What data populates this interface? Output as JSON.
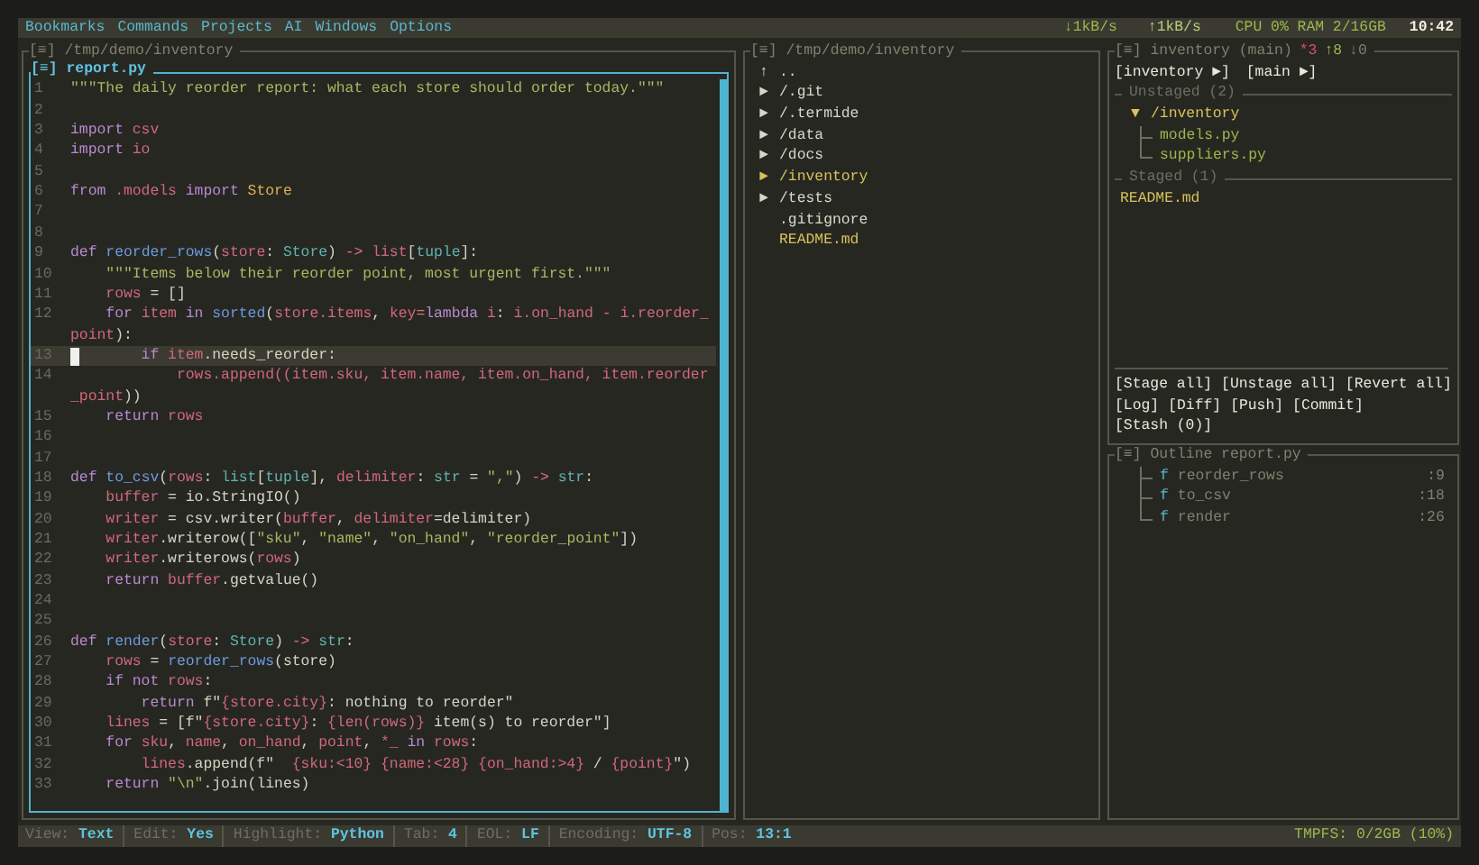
{
  "menu_bar": {
    "items": [
      "Bookmarks",
      "Commands",
      "Projects",
      "AI",
      "Windows",
      "Options"
    ],
    "net_down": "↓1kB/s",
    "net_up": "↑1kB/s",
    "system": "CPU 0% RAM 2/16GB",
    "clock": "10:42"
  },
  "project_panel": {
    "glyph": "[≡]",
    "title": "/tmp/demo/inventory"
  },
  "editor": {
    "glyph": "[≡]",
    "title": "report.py",
    "rows": [
      {
        "number": "1",
        "current": false,
        "tokens": [
          {
            "text": "\"\"\"The daily reorder report: what each store should order today.\"\"\"",
            "kind": "s"
          }
        ]
      },
      {
        "number": "2",
        "current": false,
        "tokens": []
      },
      {
        "number": "3",
        "current": false,
        "tokens": [
          {
            "text": "import",
            "kind": "k"
          },
          {
            "text": " csv",
            "kind": "v"
          }
        ]
      },
      {
        "number": "4",
        "current": false,
        "tokens": [
          {
            "text": "import",
            "kind": "k"
          },
          {
            "text": " io",
            "kind": "v"
          }
        ]
      },
      {
        "number": "5",
        "current": false,
        "tokens": []
      },
      {
        "number": "6",
        "current": false,
        "tokens": [
          {
            "text": "from",
            "kind": "k"
          },
          {
            "text": " .models",
            "kind": "v"
          },
          {
            "text": " import",
            "kind": "k"
          },
          {
            "text": " Store",
            "kind": "c"
          }
        ]
      },
      {
        "number": "7",
        "current": false,
        "tokens": []
      },
      {
        "number": "8",
        "current": false,
        "tokens": []
      },
      {
        "number": "9",
        "current": false,
        "tokens": [
          {
            "text": "def",
            "kind": "k"
          },
          {
            "text": " reorder_rows",
            "kind": "f"
          },
          {
            "text": "(",
            "kind": "p"
          },
          {
            "text": "store",
            "kind": "v"
          },
          {
            "text": ": ",
            "kind": "p"
          },
          {
            "text": "Store",
            "kind": "t"
          },
          {
            "text": ") ",
            "kind": "p"
          },
          {
            "text": "->",
            "kind": "o"
          },
          {
            "text": " list",
            "kind": "v"
          },
          {
            "text": "[",
            "kind": "p"
          },
          {
            "text": "tuple",
            "kind": "t"
          },
          {
            "text": "]:",
            "kind": "p"
          }
        ]
      },
      {
        "number": "10",
        "current": false,
        "tokens": [
          {
            "text": "    \"\"\"Items below their reorder point, most urgent first.\"\"\"",
            "kind": "s"
          }
        ]
      },
      {
        "number": "11",
        "current": false,
        "tokens": [
          {
            "text": "    rows",
            "kind": "v"
          },
          {
            "text": " = []",
            "kind": "p"
          }
        ]
      },
      {
        "number": "12",
        "current": false,
        "tokens": [
          {
            "text": "    for",
            "kind": "k"
          },
          {
            "text": " item",
            "kind": "v"
          },
          {
            "text": " in",
            "kind": "k"
          },
          {
            "text": " sorted",
            "kind": "f"
          },
          {
            "text": "(",
            "kind": "p"
          },
          {
            "text": "store.items",
            "kind": "v"
          },
          {
            "text": ", ",
            "kind": "p"
          },
          {
            "text": "key",
            "kind": "v"
          },
          {
            "text": "=",
            "kind": "o"
          },
          {
            "text": "lambda",
            "kind": "k"
          },
          {
            "text": " i",
            "kind": "v"
          },
          {
            "text": ": ",
            "kind": "p"
          },
          {
            "text": "i.on_hand",
            "kind": "v"
          },
          {
            "text": " - ",
            "kind": "o"
          },
          {
            "text": "i.reorder_",
            "kind": "v"
          }
        ]
      },
      {
        "current": false,
        "tokens": [
          {
            "text": "point",
            "kind": "v"
          },
          {
            "text": "):",
            "kind": "p"
          }
        ]
      },
      {
        "number": "13",
        "current": true,
        "tokens": [
          {
            "text": "        if",
            "kind": "k"
          },
          {
            "text": " item",
            "kind": "v"
          },
          {
            "text": ".needs_reorder:",
            "kind": "p"
          }
        ]
      },
      {
        "number": "14",
        "current": false,
        "tokens": [
          {
            "text": "            rows.append((item.sku, item.name, item.on_hand, item.reorder",
            "kind": "v"
          }
        ]
      },
      {
        "current": false,
        "tokens": [
          {
            "text": "_point",
            "kind": "v"
          },
          {
            "text": "))",
            "kind": "p"
          }
        ]
      },
      {
        "number": "15",
        "current": false,
        "tokens": [
          {
            "text": "    return",
            "kind": "k"
          },
          {
            "text": " rows",
            "kind": "v"
          }
        ]
      },
      {
        "number": "16",
        "current": false,
        "tokens": []
      },
      {
        "number": "17",
        "current": false,
        "tokens": []
      },
      {
        "number": "18",
        "current": false,
        "tokens": [
          {
            "text": "def",
            "kind": "k"
          },
          {
            "text": " to_csv",
            "kind": "f"
          },
          {
            "text": "(",
            "kind": "p"
          },
          {
            "text": "rows",
            "kind": "v"
          },
          {
            "text": ": ",
            "kind": "p"
          },
          {
            "text": "list",
            "kind": "t"
          },
          {
            "text": "[",
            "kind": "p"
          },
          {
            "text": "tuple",
            "kind": "t"
          },
          {
            "text": "], ",
            "kind": "p"
          },
          {
            "text": "delimiter",
            "kind": "v"
          },
          {
            "text": ": ",
            "kind": "p"
          },
          {
            "text": "str",
            "kind": "t"
          },
          {
            "text": " = ",
            "kind": "p"
          },
          {
            "text": "\",\"",
            "kind": "s"
          },
          {
            "text": ") ",
            "kind": "p"
          },
          {
            "text": "->",
            "kind": "o"
          },
          {
            "text": " str",
            "kind": "t"
          },
          {
            "text": ":",
            "kind": "p"
          }
        ]
      },
      {
        "number": "19",
        "current": false,
        "tokens": [
          {
            "text": "    buffer",
            "kind": "v"
          },
          {
            "text": " = io.StringIO()",
            "kind": "p"
          }
        ]
      },
      {
        "number": "20",
        "current": false,
        "tokens": [
          {
            "text": "    writer",
            "kind": "v"
          },
          {
            "text": " = csv.writer(",
            "kind": "p"
          },
          {
            "text": "buffer",
            "kind": "v"
          },
          {
            "text": ", ",
            "kind": "p"
          },
          {
            "text": "delimiter",
            "kind": "v"
          },
          {
            "text": "=delimiter)",
            "kind": "p"
          }
        ]
      },
      {
        "number": "21",
        "current": false,
        "tokens": [
          {
            "text": "    writer",
            "kind": "v"
          },
          {
            "text": ".writerow([",
            "kind": "p"
          },
          {
            "text": "\"sku\"",
            "kind": "s"
          },
          {
            "text": ", ",
            "kind": "p"
          },
          {
            "text": "\"name\"",
            "kind": "s"
          },
          {
            "text": ", ",
            "kind": "p"
          },
          {
            "text": "\"on_hand\"",
            "kind": "s"
          },
          {
            "text": ", ",
            "kind": "p"
          },
          {
            "text": "\"reorder_point\"",
            "kind": "s"
          },
          {
            "text": "])",
            "kind": "p"
          }
        ]
      },
      {
        "number": "22",
        "current": false,
        "tokens": [
          {
            "text": "    writer",
            "kind": "v"
          },
          {
            "text": ".writerows(",
            "kind": "p"
          },
          {
            "text": "rows",
            "kind": "v"
          },
          {
            "text": ")",
            "kind": "p"
          }
        ]
      },
      {
        "number": "23",
        "current": false,
        "tokens": [
          {
            "text": "    return",
            "kind": "k"
          },
          {
            "text": " buffer",
            "kind": "v"
          },
          {
            "text": ".getvalue()",
            "kind": "p"
          }
        ]
      },
      {
        "number": "24",
        "current": false,
        "tokens": []
      },
      {
        "number": "25",
        "current": false,
        "tokens": []
      },
      {
        "number": "26",
        "current": false,
        "tokens": [
          {
            "text": "def",
            "kind": "k"
          },
          {
            "text": " render",
            "kind": "f"
          },
          {
            "text": "(",
            "kind": "p"
          },
          {
            "text": "store",
            "kind": "v"
          },
          {
            "text": ": ",
            "kind": "p"
          },
          {
            "text": "Store",
            "kind": "t"
          },
          {
            "text": ") ",
            "kind": "p"
          },
          {
            "text": "->",
            "kind": "o"
          },
          {
            "text": " str",
            "kind": "t"
          },
          {
            "text": ":",
            "kind": "p"
          }
        ]
      },
      {
        "number": "27",
        "current": false,
        "tokens": [
          {
            "text": "    rows",
            "kind": "v"
          },
          {
            "text": " = ",
            "kind": "p"
          },
          {
            "text": "reorder_rows",
            "kind": "f"
          },
          {
            "text": "(store)",
            "kind": "p"
          }
        ]
      },
      {
        "number": "28",
        "current": false,
        "tokens": [
          {
            "text": "    if",
            "kind": "k"
          },
          {
            "text": " not",
            "kind": "k"
          },
          {
            "text": " rows",
            "kind": "v"
          },
          {
            "text": ":",
            "kind": "p"
          }
        ]
      },
      {
        "number": "29",
        "current": false,
        "tokens": [
          {
            "text": "        return",
            "kind": "k"
          },
          {
            "text": " f\"",
            "kind": "p"
          },
          {
            "text": "{store.city}",
            "kind": "v"
          },
          {
            "text": ": nothing to reorder\"",
            "kind": "p"
          }
        ]
      },
      {
        "number": "30",
        "current": false,
        "tokens": [
          {
            "text": "    lines",
            "kind": "v"
          },
          {
            "text": " = [f\"",
            "kind": "p"
          },
          {
            "text": "{store.city}",
            "kind": "v"
          },
          {
            "text": ": ",
            "kind": "p"
          },
          {
            "text": "{len(rows)}",
            "kind": "v"
          },
          {
            "text": " item(s) to reorder\"]",
            "kind": "p"
          }
        ]
      },
      {
        "number": "31",
        "current": false,
        "tokens": [
          {
            "text": "    for",
            "kind": "k"
          },
          {
            "text": " sku",
            "kind": "v"
          },
          {
            "text": ", ",
            "kind": "p"
          },
          {
            "text": "name",
            "kind": "v"
          },
          {
            "text": ", ",
            "kind": "p"
          },
          {
            "text": "on_hand",
            "kind": "v"
          },
          {
            "text": ", ",
            "kind": "p"
          },
          {
            "text": "point",
            "kind": "v"
          },
          {
            "text": ", ",
            "kind": "p"
          },
          {
            "text": "*_",
            "kind": "v"
          },
          {
            "text": " in",
            "kind": "k"
          },
          {
            "text": " rows",
            "kind": "v"
          },
          {
            "text": ":",
            "kind": "p"
          }
        ]
      },
      {
        "number": "32",
        "current": false,
        "tokens": [
          {
            "text": "        lines",
            "kind": "v"
          },
          {
            "text": ".append(f\"  ",
            "kind": "p"
          },
          {
            "text": "{sku:<10}",
            "kind": "v"
          },
          {
            "text": " {name:<28}",
            "kind": "v"
          },
          {
            "text": " {on_hand:>4}",
            "kind": "v"
          },
          {
            "text": " / ",
            "kind": "p"
          },
          {
            "text": "{point}",
            "kind": "v"
          },
          {
            "text": "\")",
            "kind": "p"
          }
        ]
      },
      {
        "number": "33",
        "current": false,
        "tokens": [
          {
            "text": "    return",
            "kind": "k"
          },
          {
            "text": " \"\\n\"",
            "kind": "s"
          },
          {
            "text": ".join(lines)",
            "kind": "p"
          }
        ]
      }
    ]
  },
  "file_browser": {
    "glyph": "[≡]",
    "title": "/tmp/demo/inventory",
    "entries": [
      {
        "marker": "↑",
        "name": "..",
        "color": "#d8d8c8"
      },
      {
        "marker": "►",
        "name": "/.git",
        "color": "#d8d8c8"
      },
      {
        "marker": "►",
        "name": "/.termide",
        "color": "#d8d8c8"
      },
      {
        "marker": "►",
        "name": "/data",
        "color": "#d8d8c8"
      },
      {
        "marker": "►",
        "name": "/docs",
        "color": "#d8d8c8"
      },
      {
        "marker": "►",
        "name": "/inventory",
        "color": "#d8c25a"
      },
      {
        "marker": "►",
        "name": "/tests",
        "color": "#d8d8c8"
      },
      {
        "name": ".gitignore",
        "color": "#d8d8c8"
      },
      {
        "name": "README.md",
        "color": "#d8c25a"
      }
    ]
  },
  "git_panel": {
    "glyph": "[≡]",
    "title": "inventory (main)",
    "changes": "*3",
    "ahead": "↑8",
    "behind": "↓0",
    "branches": [
      "[inventory ►]",
      "[main ►]"
    ],
    "sections": [
      {
        "title": "Unstaged (2)",
        "items": [
          {
            "marker": "▼",
            "name": "/inventory",
            "color": "#d8c25a",
            "children": [
              {
                "name": "models.py",
                "color": "#9ab84c"
              },
              {
                "name": "suppliers.py",
                "color": "#9ab84c"
              }
            ]
          }
        ]
      },
      {
        "title": "Staged (1)",
        "items": [
          {
            "name": "README.md",
            "color": "#d8c25a"
          }
        ]
      }
    ],
    "actions": [
      [
        "[Stage all]",
        "[Unstage all]",
        "[Revert all]"
      ],
      [
        "[Log]",
        "[Diff]",
        "[Push]",
        "[Commit]"
      ],
      [
        "[Stash (0)]"
      ]
    ]
  },
  "outline": {
    "glyph": "[≡]",
    "title": "Outline report.py",
    "symbols": [
      {
        "kind_glyph": "f",
        "name": "reorder_rows",
        "line": ":9"
      },
      {
        "kind_glyph": "f",
        "name": "to_csv",
        "line": ":18"
      },
      {
        "kind_glyph": "f",
        "name": "render",
        "line": ":26"
      }
    ]
  },
  "status_bar": {
    "fields": [
      {
        "label": "View:",
        "value": "Text"
      },
      {
        "label": "Edit:",
        "value": "Yes"
      },
      {
        "label": "Highlight:",
        "value": "Python"
      },
      {
        "label": "Tab:",
        "value": "4"
      },
      {
        "label": "EOL:",
        "value": "LF"
      },
      {
        "label": "Encoding:",
        "value": "UTF-8"
      },
      {
        "label": "Pos:",
        "value": "13:1"
      }
    ],
    "tmpfs": "TMPFS: 0/2GB (10%)"
  }
}
